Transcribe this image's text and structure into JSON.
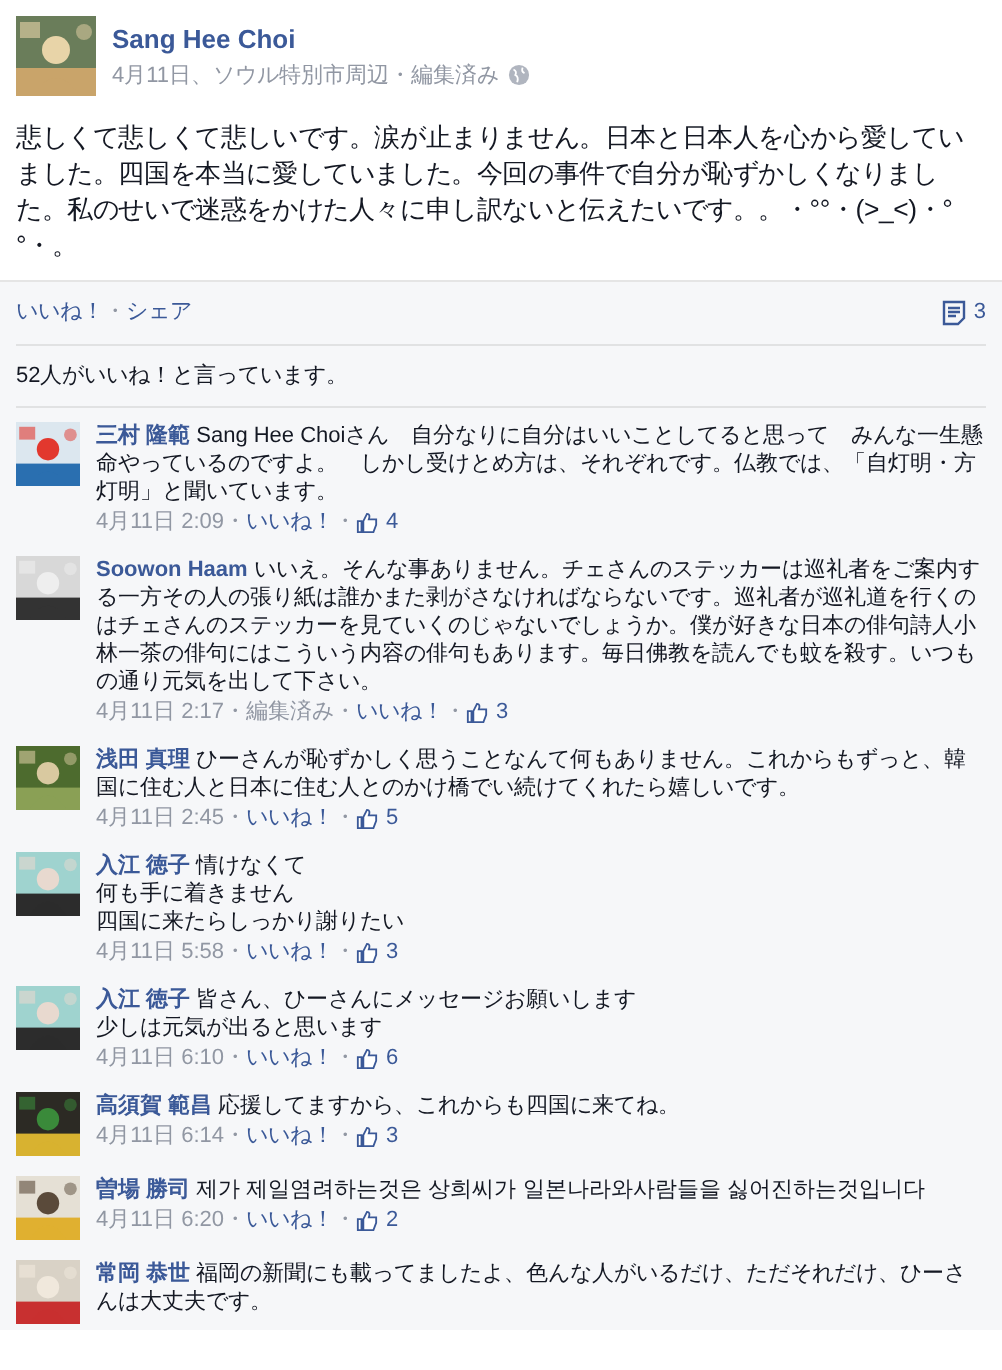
{
  "post": {
    "author": "Sang Hee Choi",
    "meta": "4月11日、ソウル特別市周辺・編集済み",
    "text": "悲しくて悲しくて悲しいです。涙が止まりません。日本と日本人を心から愛していました。四国を本当に愛していました。今回の事件で自分が恥ずかしくなりました。私のせいで迷惑をかけた人々に申し訳ないと伝えたいです。。・°°・(>_<)・°°・。"
  },
  "actions": [
    {
      "kind": "link",
      "text": "いいね！"
    },
    {
      "kind": "sep",
      "text": "・"
    },
    {
      "kind": "link",
      "text": "シェア"
    }
  ],
  "comment_count": "3",
  "likes_summary": "52人がいいね！と言っています。",
  "comments": [
    {
      "name": "三村 隆範",
      "text": "Sang Hee Choiさん　自分なりに自分はいいことしてると思って　みんな一生懸命やっているのですよ。　しかし受けとめ方は、それぞれです。仏教では、「自灯明・方灯明」と聞いています。",
      "meta": [
        {
          "kind": "time",
          "text": "4月11日 2:09"
        },
        {
          "kind": "sep",
          "text": "・"
        },
        {
          "kind": "link",
          "text": "いいね！"
        },
        {
          "kind": "sep",
          "text": "・"
        },
        {
          "kind": "likes",
          "text": "4"
        }
      ]
    },
    {
      "name": "Soowon Haam",
      "text": "いいえ。そんな事ありません。チェさんのステッカーは巡礼者をご案内する一方その人の張り紙は誰かまた剥がさなければならないです。巡礼者が巡礼道を行くのはチェさんのステッカーを見ていくのじゃないでしょうか。僕が好きな日本の俳句詩人小林一茶の俳句にはこういう内容の俳句もあります。毎日佛教を読んでも蚊を殺す。いつもの通り元気を出して下さい。",
      "meta": [
        {
          "kind": "time",
          "text": "4月11日 2:17"
        },
        {
          "kind": "sep",
          "text": "・"
        },
        {
          "kind": "time",
          "text": "編集済み"
        },
        {
          "kind": "sep",
          "text": "・"
        },
        {
          "kind": "link",
          "text": "いいね！"
        },
        {
          "kind": "sep",
          "text": "・"
        },
        {
          "kind": "likes",
          "text": "3"
        }
      ]
    },
    {
      "name": "浅田 真理",
      "text": "ひーさんが恥ずかしく思うことなんて何もありません。これからもずっと、韓国に住む人と日本に住む人とのかけ橋でい続けてくれたら嬉しいです。",
      "meta": [
        {
          "kind": "time",
          "text": "4月11日 2:45"
        },
        {
          "kind": "sep",
          "text": "・"
        },
        {
          "kind": "link",
          "text": "いいね！"
        },
        {
          "kind": "sep",
          "text": "・"
        },
        {
          "kind": "likes",
          "text": "5"
        }
      ]
    },
    {
      "name": "入江 徳子",
      "text": "情けなくて",
      "more_lines": [
        "何も手に着きません",
        "四国に来たらしっかり謝りたい"
      ],
      "meta": [
        {
          "kind": "time",
          "text": "4月11日 5:58"
        },
        {
          "kind": "sep",
          "text": "・"
        },
        {
          "kind": "link",
          "text": "いいね！"
        },
        {
          "kind": "sep",
          "text": "・"
        },
        {
          "kind": "likes",
          "text": "3"
        }
      ]
    },
    {
      "name": "入江 徳子",
      "text": "皆さん、ひーさんにメッセージお願いします",
      "more_lines": [
        "少しは元気が出ると思います"
      ],
      "meta": [
        {
          "kind": "time",
          "text": "4月11日 6:10"
        },
        {
          "kind": "sep",
          "text": "・"
        },
        {
          "kind": "link",
          "text": "いいね！"
        },
        {
          "kind": "sep",
          "text": "・"
        },
        {
          "kind": "likes",
          "text": "6"
        }
      ]
    },
    {
      "name": "高須賀 範昌",
      "text": "応援してますから、これからも四国に来てね。",
      "meta": [
        {
          "kind": "time",
          "text": "4月11日 6:14"
        },
        {
          "kind": "sep",
          "text": "・"
        },
        {
          "kind": "link",
          "text": "いいね！"
        },
        {
          "kind": "sep",
          "text": "・"
        },
        {
          "kind": "likes",
          "text": "3"
        }
      ]
    },
    {
      "name": "曽場 勝司",
      "text": "제가 제일염려하는것은 상희씨가 일본나라와사람들을 싫어진하는것입니다",
      "meta": [
        {
          "kind": "time",
          "text": "4月11日 6:20"
        },
        {
          "kind": "sep",
          "text": "・"
        },
        {
          "kind": "link",
          "text": "いいね！"
        },
        {
          "kind": "sep",
          "text": "・"
        },
        {
          "kind": "likes",
          "text": "2"
        }
      ]
    },
    {
      "name": "常岡 恭世",
      "text": "福岡の新聞にも載ってましたよ、色んな人がいるだけ、ただそれだけ、ひーさんは大丈夫です。"
    }
  ]
}
